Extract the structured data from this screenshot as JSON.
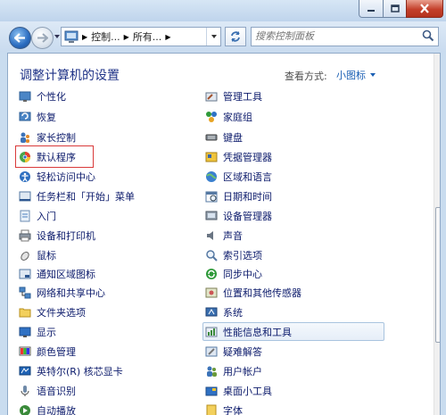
{
  "window": {
    "controls": {
      "minimize_icon": "minimize-icon",
      "maximize_icon": "maximize-icon",
      "close_icon": "close-icon"
    }
  },
  "navigation": {
    "breadcrumb": [
      "控制...",
      "所有..."
    ],
    "search_placeholder": "搜索控制面板"
  },
  "header": {
    "title": "调整计算机的设置",
    "view_by_label": "查看方式:",
    "view_by_value": "小图标"
  },
  "items_left": [
    {
      "label": "个性化",
      "icon": "personalization-icon"
    },
    {
      "label": "恢复",
      "icon": "recovery-icon"
    },
    {
      "label": "家长控制",
      "icon": "parental-controls-icon"
    },
    {
      "label": "默认程序",
      "icon": "default-programs-icon"
    },
    {
      "label": "轻松访问中心",
      "icon": "ease-of-access-icon"
    },
    {
      "label": "任务栏和「开始」菜单",
      "icon": "taskbar-icon"
    },
    {
      "label": "入门",
      "icon": "getting-started-icon"
    },
    {
      "label": "设备和打印机",
      "icon": "printer-icon"
    },
    {
      "label": "鼠标",
      "icon": "mouse-icon"
    },
    {
      "label": "通知区域图标",
      "icon": "notification-icon"
    },
    {
      "label": "网络和共享中心",
      "icon": "network-icon"
    },
    {
      "label": "文件夹选项",
      "icon": "folder-icon"
    },
    {
      "label": "显示",
      "icon": "display-icon"
    },
    {
      "label": "颜色管理",
      "icon": "color-management-icon"
    },
    {
      "label": "英特尔(R) 核芯显卡",
      "icon": "intel-graphics-icon"
    },
    {
      "label": "语音识别",
      "icon": "speech-recognition-icon"
    },
    {
      "label": "自动播放",
      "icon": "autoplay-icon"
    }
  ],
  "items_right": [
    {
      "label": "管理工具",
      "icon": "admin-tools-icon"
    },
    {
      "label": "家庭组",
      "icon": "homegroup-icon"
    },
    {
      "label": "键盘",
      "icon": "keyboard-icon"
    },
    {
      "label": "凭据管理器",
      "icon": "credential-manager-icon"
    },
    {
      "label": "区域和语言",
      "icon": "region-language-icon"
    },
    {
      "label": "日期和时间",
      "icon": "date-time-icon"
    },
    {
      "label": "设备管理器",
      "icon": "device-manager-icon"
    },
    {
      "label": "声音",
      "icon": "sound-icon"
    },
    {
      "label": "索引选项",
      "icon": "indexing-icon"
    },
    {
      "label": "同步中心",
      "icon": "sync-center-icon"
    },
    {
      "label": "位置和其他传感器",
      "icon": "location-sensors-icon"
    },
    {
      "label": "系统",
      "icon": "system-icon"
    },
    {
      "label": "性能信息和工具",
      "icon": "performance-icon"
    },
    {
      "label": "疑难解答",
      "icon": "troubleshooting-icon"
    },
    {
      "label": "用户帐户",
      "icon": "user-accounts-icon"
    },
    {
      "label": "桌面小工具",
      "icon": "gadgets-icon"
    },
    {
      "label": "字体",
      "icon": "fonts-icon"
    }
  ]
}
